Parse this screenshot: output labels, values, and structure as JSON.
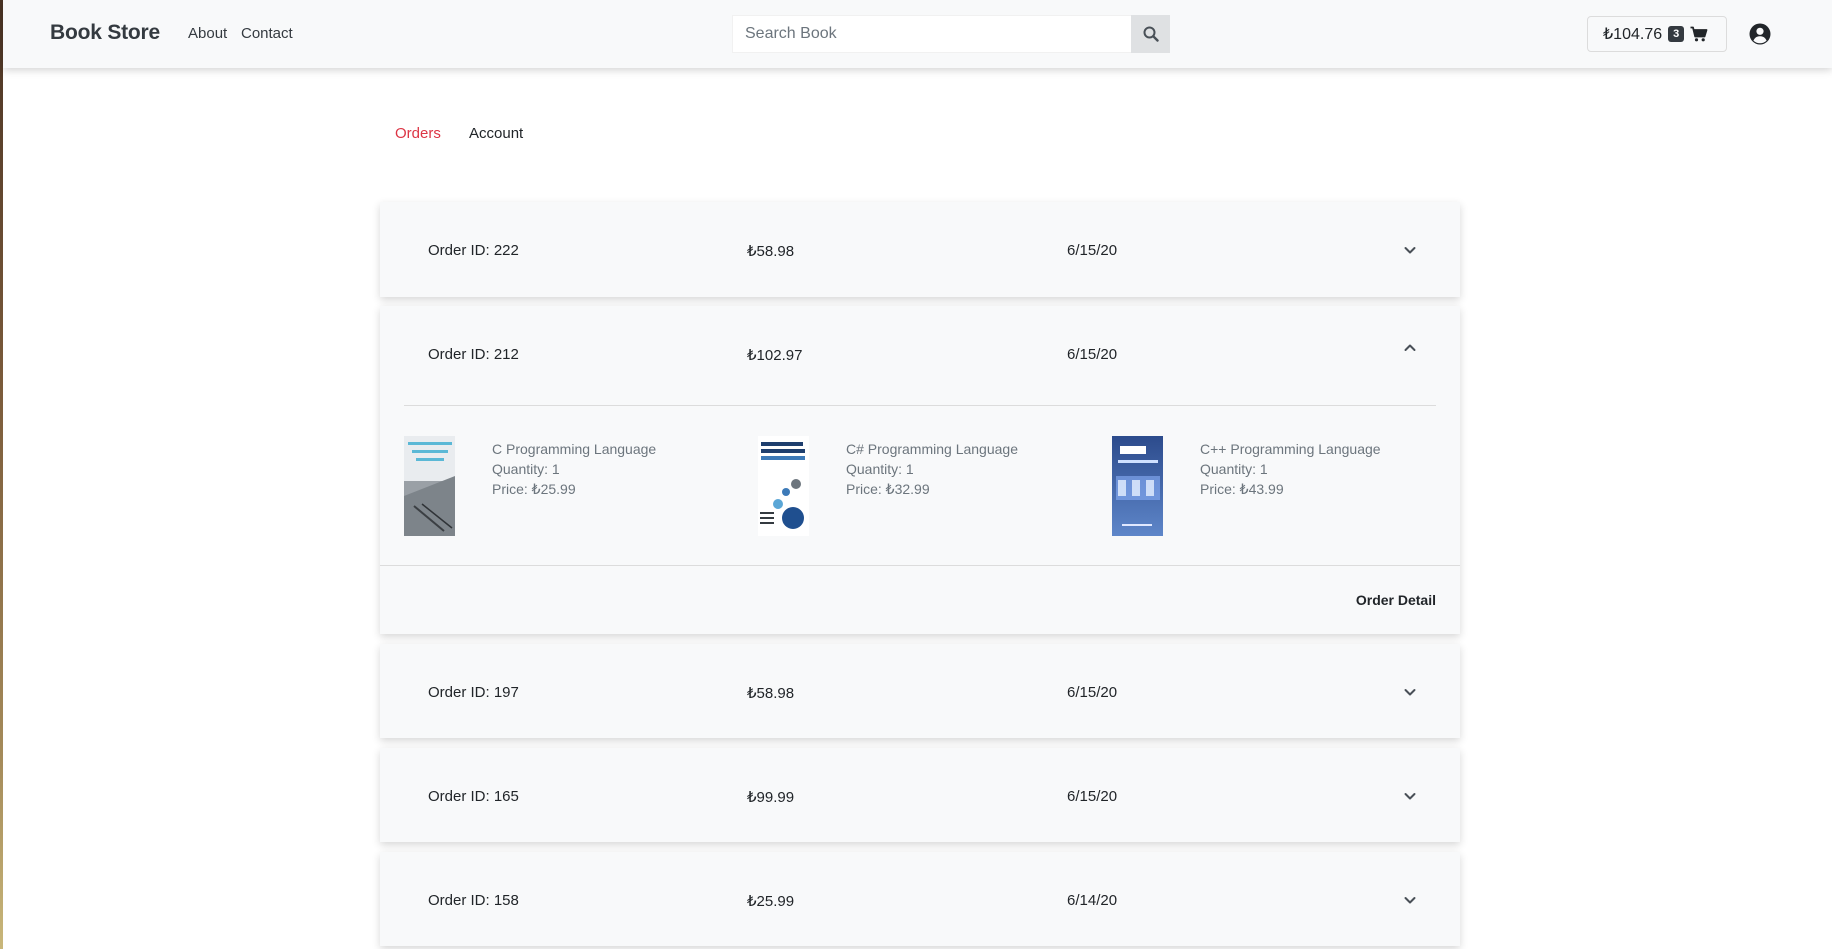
{
  "navbar": {
    "brand": "Book Store",
    "links": [
      "About",
      "Contact"
    ],
    "search_placeholder": "Search Book",
    "cart_total": "₺104.76",
    "cart_count": "3"
  },
  "tabs": {
    "orders": "Orders",
    "account": "Account"
  },
  "orders": [
    {
      "id_label": "Order ID: 222",
      "total": "₺58.98",
      "date": "6/15/20",
      "expanded": false
    },
    {
      "id_label": "Order ID: 212",
      "total": "₺102.97",
      "date": "6/15/20",
      "expanded": true,
      "items": [
        {
          "title": "C Programming Language",
          "quantity": "Quantity: 1",
          "price": "Price: ₺25.99"
        },
        {
          "title": "C# Programming Language",
          "quantity": "Quantity: 1",
          "price": "Price: ₺32.99"
        },
        {
          "title": "C++ Programming Language",
          "quantity": "Quantity: 1",
          "price": "Price: ₺43.99"
        }
      ],
      "detail_label": "Order Detail"
    },
    {
      "id_label": "Order ID: 197",
      "total": "₺58.98",
      "date": "6/15/20",
      "expanded": false
    },
    {
      "id_label": "Order ID: 165",
      "total": "₺99.99",
      "date": "6/15/20",
      "expanded": false
    },
    {
      "id_label": "Order ID: 158",
      "total": "₺25.99",
      "date": "6/14/20",
      "expanded": false
    }
  ],
  "colors": {
    "active_tab": "#dc3545",
    "navbar_bg": "#f8f9fa",
    "card_bg": "#f8f9fa"
  },
  "icons": {
    "search": "search-icon",
    "cart": "cart-icon",
    "user": "user-circle-icon",
    "expand": "chevron-down-icon",
    "collapse": "chevron-up-icon"
  }
}
